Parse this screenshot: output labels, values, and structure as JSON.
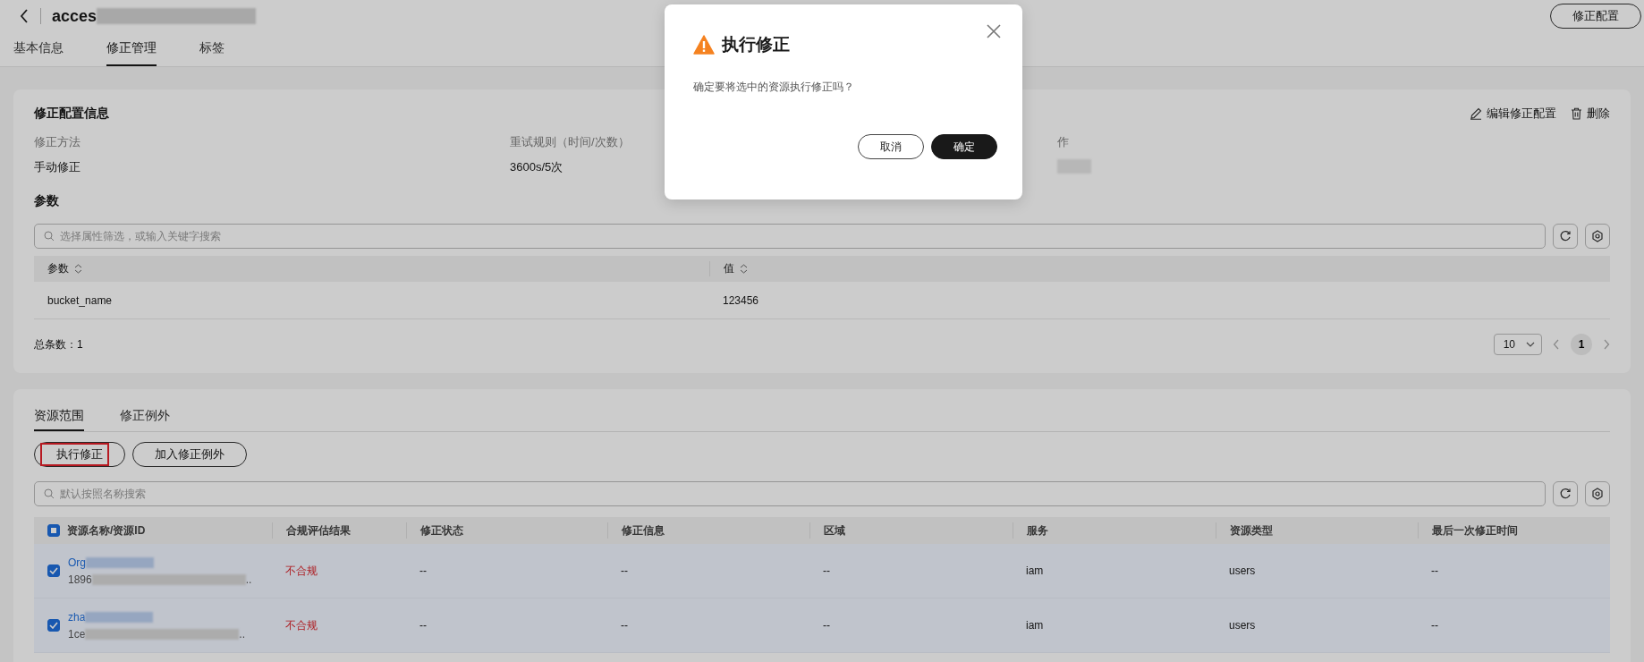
{
  "header": {
    "title": "acces",
    "button": "修正配置"
  },
  "tabs": [
    {
      "label": "基本信息",
      "selected": false
    },
    {
      "label": "修正管理",
      "selected": true
    },
    {
      "label": "标签",
      "selected": false
    }
  ],
  "config_card": {
    "title": "修正配置信息",
    "actions": [
      {
        "kind": "edit",
        "label": "编辑修正配置"
      },
      {
        "kind": "delete",
        "label": "删除"
      }
    ],
    "fields": [
      {
        "label": "修正方法",
        "value": "手动修正"
      },
      {
        "label": "重试规则（时间/次数）",
        "value": "3600s/5次"
      },
      {
        "label": "作"
      }
    ],
    "params_title": "参数",
    "search": {
      "placeholder": "选择属性筛选，或输入关键字搜索"
    },
    "table": {
      "columns": [
        {
          "label": "参数",
          "sortable": true
        },
        {
          "label": "值",
          "sortable": true
        }
      ],
      "rows": [
        [
          "bucket_name",
          "123456"
        ]
      ]
    },
    "total": "总条数：1",
    "page_size": "10",
    "pages": [
      {
        "label": "1",
        "selected": true
      }
    ]
  },
  "resource_card": {
    "tabs": [
      {
        "label": "资源范围",
        "selected": true
      },
      {
        "label": "修正例外",
        "selected": false
      }
    ],
    "buttons": [
      {
        "label": "执行修正",
        "highlighted": true
      },
      {
        "label": "加入修正例外",
        "highlighted": false
      }
    ],
    "search": {
      "placeholder": "默认按照名称搜索"
    },
    "table": {
      "select_all": {
        "indeterminate": true
      },
      "columns": [
        "资源名称/资源ID",
        "合规评估结果",
        "修正状态",
        "修正信息",
        "区域",
        "服务",
        "资源类型",
        "最后一次修正时间"
      ],
      "rows": [
        {
          "selected": true,
          "name": "Org",
          "id": "1896",
          "id_tail": "..",
          "compliant": false,
          "result": "不合规",
          "status": "--",
          "info": "--",
          "region": "--",
          "service": "iam",
          "type": "users",
          "last_fix": "--"
        },
        {
          "selected": true,
          "name": "zha",
          "id": "1ce",
          "id_tail": "..",
          "compliant": false,
          "result": "不合规",
          "status": "--",
          "info": "--",
          "region": "--",
          "service": "iam",
          "type": "users",
          "last_fix": "--"
        }
      ]
    }
  },
  "dialog": {
    "title": "执行修正",
    "message": "确定要将选中的资源执行修正吗？",
    "buttons": [
      {
        "kind": "secondary",
        "label": "取消"
      },
      {
        "kind": "primary",
        "label": "确定"
      }
    ]
  }
}
